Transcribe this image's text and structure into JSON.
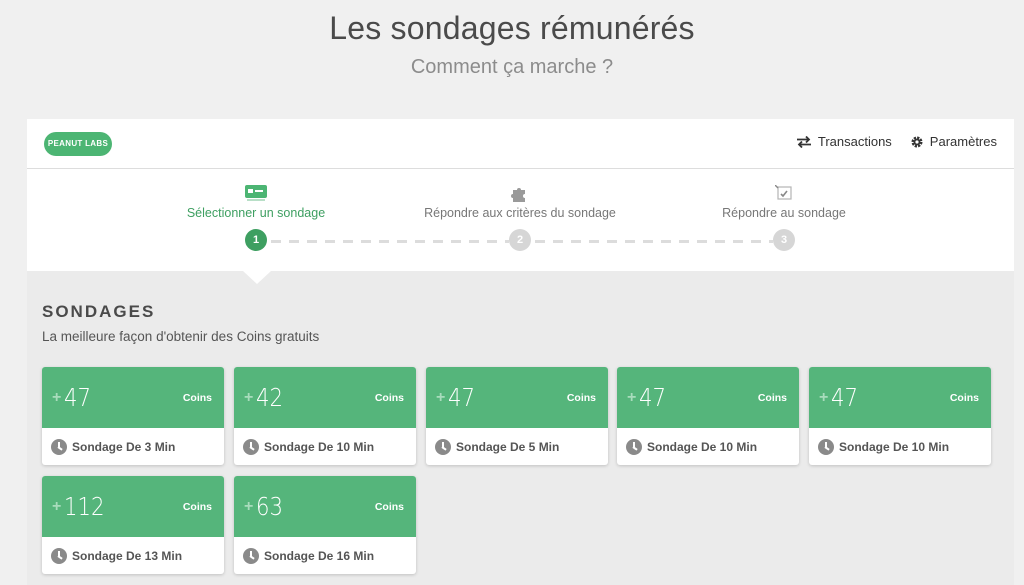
{
  "page": {
    "title": "Les sondages rémunérés",
    "subtitle": "Comment ça marche ?"
  },
  "header": {
    "logo_text": "PEANUT LABS",
    "nav": [
      {
        "label": "Transactions",
        "icon": "transfer-icon"
      },
      {
        "label": "Paramètres",
        "icon": "gear-icon"
      }
    ]
  },
  "steps": [
    {
      "number": "1",
      "label": "Sélectionner un sondage",
      "icon": "card-icon",
      "active": true
    },
    {
      "number": "2",
      "label": "Répondre aux critères du sondage",
      "icon": "puzzle-icon",
      "active": false
    },
    {
      "number": "3",
      "label": "Répondre au sondage",
      "icon": "checklist-icon",
      "active": false
    }
  ],
  "section": {
    "title": "SONDAGES",
    "subtitle": "La meilleure façon d'obtenir des Coins gratuits"
  },
  "surveys": [
    {
      "value": "47",
      "unit": "Coins",
      "label": "Sondage De 3 Min"
    },
    {
      "value": "42",
      "unit": "Coins",
      "label": "Sondage De 10 Min"
    },
    {
      "value": "47",
      "unit": "Coins",
      "label": "Sondage De 5 Min"
    },
    {
      "value": "47",
      "unit": "Coins",
      "label": "Sondage De 10 Min"
    },
    {
      "value": "47",
      "unit": "Coins",
      "label": "Sondage De 10 Min"
    },
    {
      "value": "112",
      "unit": "Coins",
      "label": "Sondage De 13 Min"
    },
    {
      "value": "63",
      "unit": "Coins",
      "label": "Sondage De 16 Min"
    }
  ],
  "colors": {
    "accent": "#55b57b",
    "active_step": "#3e9f61",
    "inactive_step": "#d6d6d6"
  }
}
